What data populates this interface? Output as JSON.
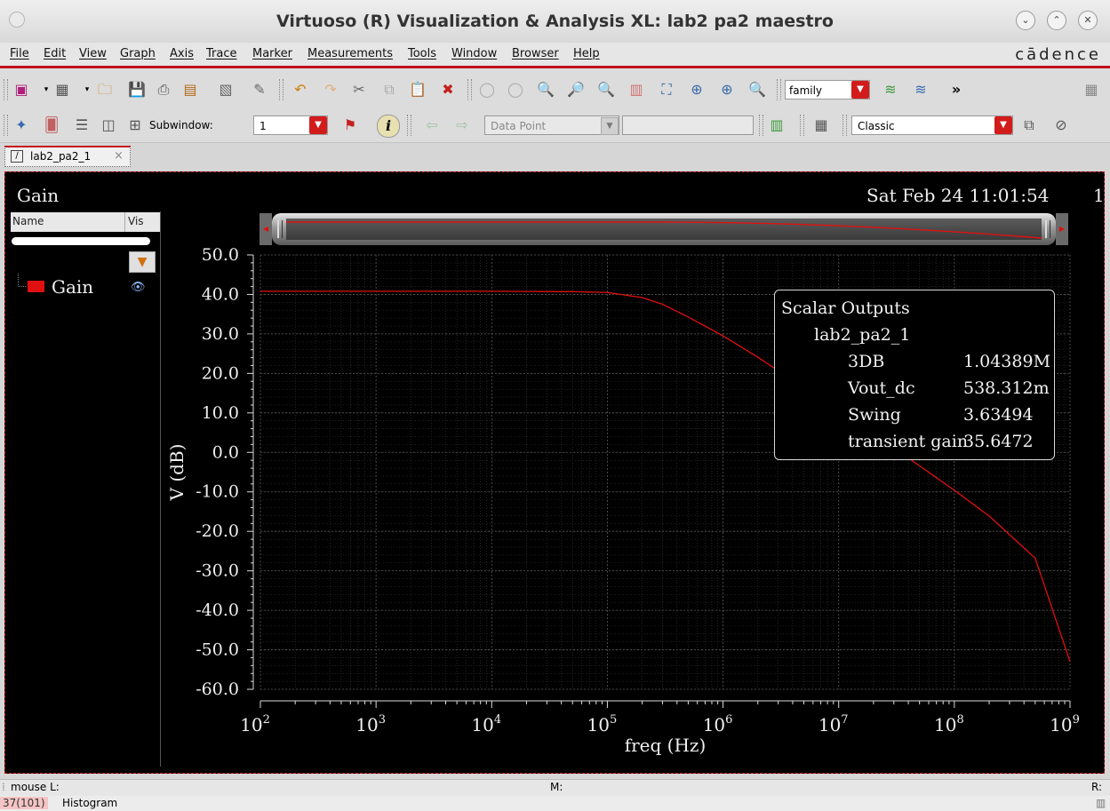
{
  "window": {
    "title": "Virtuoso (R) Visualization & Analysis XL: lab2 pa2 maestro",
    "controls": [
      "⌄",
      "⌃",
      "✕"
    ]
  },
  "menubar": {
    "items": [
      "File",
      "Edit",
      "View",
      "Graph",
      "Axis",
      "Trace",
      "Marker",
      "Measurements",
      "Tools",
      "Window",
      "Browser",
      "Help"
    ],
    "brand": "cādence"
  },
  "toolbar1": {
    "family_combo": "family"
  },
  "toolbar2": {
    "subwindow_label": "Subwindow:",
    "subwindow_value": "1",
    "data_point_combo": "Data Point",
    "style_combo": "Classic"
  },
  "tab": {
    "label": "lab2_pa2_1",
    "close": "×"
  },
  "graph": {
    "title": "Gain",
    "timestamp": "Sat Feb 24 11:01:54",
    "right_edge_label": "1",
    "legend": {
      "col_name": "Name",
      "col_vis": "Vis",
      "traces": [
        {
          "name": "Gain",
          "color": "#e01010"
        }
      ]
    },
    "scalar_outputs": {
      "title": "Scalar Outputs",
      "test": "lab2_pa2_1",
      "rows": [
        {
          "name": "3DB",
          "value": "1.04389M"
        },
        {
          "name": "Vout_dc",
          "value": "538.312m"
        },
        {
          "name": "Swing",
          "value": "3.63494"
        },
        {
          "name": "transient gain",
          "value": "35.6472"
        }
      ]
    }
  },
  "chart_data": {
    "type": "line",
    "xlabel": "freq (Hz)",
    "ylabel": "V (dB)",
    "x_scale": "log",
    "xlim": [
      100,
      1000000000
    ],
    "ylim": [
      -62,
      52
    ],
    "x_ticks": [
      {
        "base": "10",
        "exp": "2",
        "value": 100
      },
      {
        "base": "10",
        "exp": "3",
        "value": 1000
      },
      {
        "base": "10",
        "exp": "4",
        "value": 10000
      },
      {
        "base": "10",
        "exp": "5",
        "value": 100000
      },
      {
        "base": "10",
        "exp": "6",
        "value": 1000000
      },
      {
        "base": "10",
        "exp": "7",
        "value": 10000000
      },
      {
        "base": "10",
        "exp": "8",
        "value": 100000000
      },
      {
        "base": "10",
        "exp": "9",
        "value": 1000000000
      }
    ],
    "y_ticks": [
      "50.0",
      "40.0",
      "30.0",
      "20.0",
      "10.0",
      "0.0",
      "-10.0",
      "-20.0",
      "-30.0",
      "-40.0",
      "-50.0",
      "-60.0"
    ],
    "grid": true,
    "series": [
      {
        "name": "Gain",
        "color": "#e01010",
        "x": [
          100,
          1000,
          10000,
          50000,
          100000,
          200000,
          300000,
          500000,
          1000000,
          2000000,
          5000000,
          10000000,
          20000000,
          50000000,
          100000000,
          200000000,
          500000000,
          1000000000
        ],
        "y": [
          40.8,
          40.8,
          40.8,
          40.7,
          40.5,
          39.2,
          37.5,
          34.3,
          29.5,
          24.1,
          16.4,
          10.6,
          4.7,
          -3.4,
          -9.6,
          -16.1,
          -26.8,
          -53.0
        ]
      }
    ]
  },
  "statusbar": {
    "left": "mouse L:",
    "middle": "M:",
    "right": "R:"
  },
  "bottom": {
    "counter": "37(101)",
    "label": "Histogram"
  }
}
